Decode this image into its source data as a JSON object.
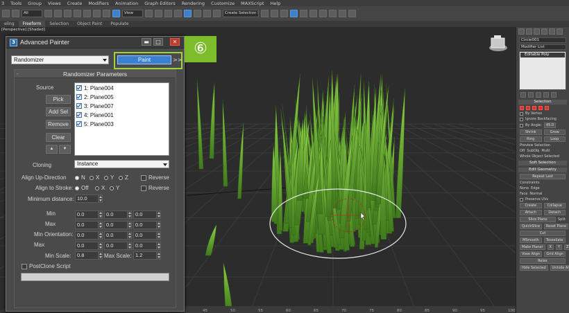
{
  "menu": [
    "3",
    "Tools",
    "Group",
    "Views",
    "Create",
    "Modifiers",
    "Animation",
    "Graph Editors",
    "Rendering",
    "Customize",
    "MAXScript",
    "Help"
  ],
  "toolbar": {
    "select_set": "All",
    "ref_coord": "View",
    "named_selection": "Create Selection Se"
  },
  "ribbon_tabs": [
    "eling",
    "Freeform",
    "Selection",
    "Object Paint",
    "Populate"
  ],
  "viewport_label": "[Perspective] [Shaded]",
  "dialog": {
    "title": "Advanced Painter",
    "minimize": "▬",
    "restore": "□",
    "close": "✕",
    "mode_value": "Randomizer",
    "paint_label": "Paint",
    "more_label": ">>",
    "step_badge": "⑥",
    "rollout_title": "Randomizer Parameters",
    "rollout_toggle": "-",
    "source_label": "Source",
    "pick_label": "Pick",
    "add_sel_label": "Add Sel",
    "remove_label": "Remove",
    "clear_label": "Clear",
    "up_arrow": "▲",
    "down_arrow": "▼",
    "source_items": [
      "1: Plane004",
      "2: Plane005",
      "3: Plane007",
      "4: Plane001",
      "5: Plane003"
    ],
    "cloning_label": "Cloning",
    "cloning_value": "Instance",
    "align_up_label": "Align Up-Direction",
    "align_up_options": [
      "N",
      "X",
      "Y",
      "Z"
    ],
    "reverse_label": "Reverse",
    "align_stroke_label": "Align to Stroke:",
    "align_stroke_options": [
      "Off",
      "X",
      "Y"
    ],
    "min_distance_label": "Minimum distance:",
    "min_distance_value": "10.0",
    "min_label": "Min",
    "max_label": "Max",
    "min_orientation_label": "Min Orientation:",
    "max2_label": "Max",
    "min_row": [
      "0.0",
      "0.0",
      "0.0"
    ],
    "max_row": [
      "0.0",
      "0.0",
      "0.0"
    ],
    "min_orient_row": [
      "0.0",
      "0.0",
      "0.0"
    ],
    "max_orient_row": [
      "0.0",
      "0.0",
      "0.0"
    ],
    "min_scale_label": "Min Scale:",
    "min_scale_value": "0.8",
    "max_scale_label": "Max Scale:",
    "max_scale_value": "1.2",
    "postclone_label": "PostClone Script",
    "progress": 0
  },
  "command_panel": {
    "object_name": "Circle001",
    "modifier_list": "Modifier List",
    "stack_item": "Editable Poly",
    "selection_title": "Selection",
    "by_vertex": "By Vertex",
    "ignore_backfacing": "Ignore Backfacing",
    "by_angle": "By Angle:",
    "by_angle_value": "45.0",
    "shrink": "Shrink",
    "grow": "Grow",
    "ring": "Ring",
    "loop": "Loop",
    "preview_selection": "Preview Selection",
    "preview_options": [
      "Off",
      "SubObj",
      "Multi"
    ],
    "whole_object": "Whole Object Selected",
    "soft_selection": "Soft Selection",
    "edit_geometry": "Edit Geometry",
    "repeat_last": "Repeat Last",
    "constraints": "Constraints",
    "none": "None",
    "edge": "Edge",
    "face": "Face",
    "normal": "Normal",
    "preserve_uvs": "Preserve UVs",
    "create": "Create",
    "collapse": "Collapse",
    "attach": "Attach",
    "detach": "Detach",
    "slice_plane": "Slice Plane",
    "split": "Split",
    "quickslice": "QuickSlice",
    "reset_plane": "Reset Plane",
    "cut": "Cut",
    "msmooth": "MSmooth",
    "tessellate": "Tessellate",
    "make_planar": "Make Planar",
    "x": "X",
    "y": "Y",
    "z": "Z",
    "view_align": "View Align",
    "grid_align": "Grid Align",
    "relax": "Relax",
    "hide_selected": "Hide Selected",
    "unhide_all": "Unhide All"
  },
  "ruler_ticks": [
    "45",
    "50",
    "55",
    "60",
    "65",
    "70",
    "75",
    "80",
    "85",
    "90",
    "95",
    "100"
  ],
  "colors": {
    "paint_button": "#3a7fd0",
    "highlight": "#9cd63a",
    "badge": "#7dbd2b",
    "grass": "#6aa832"
  }
}
